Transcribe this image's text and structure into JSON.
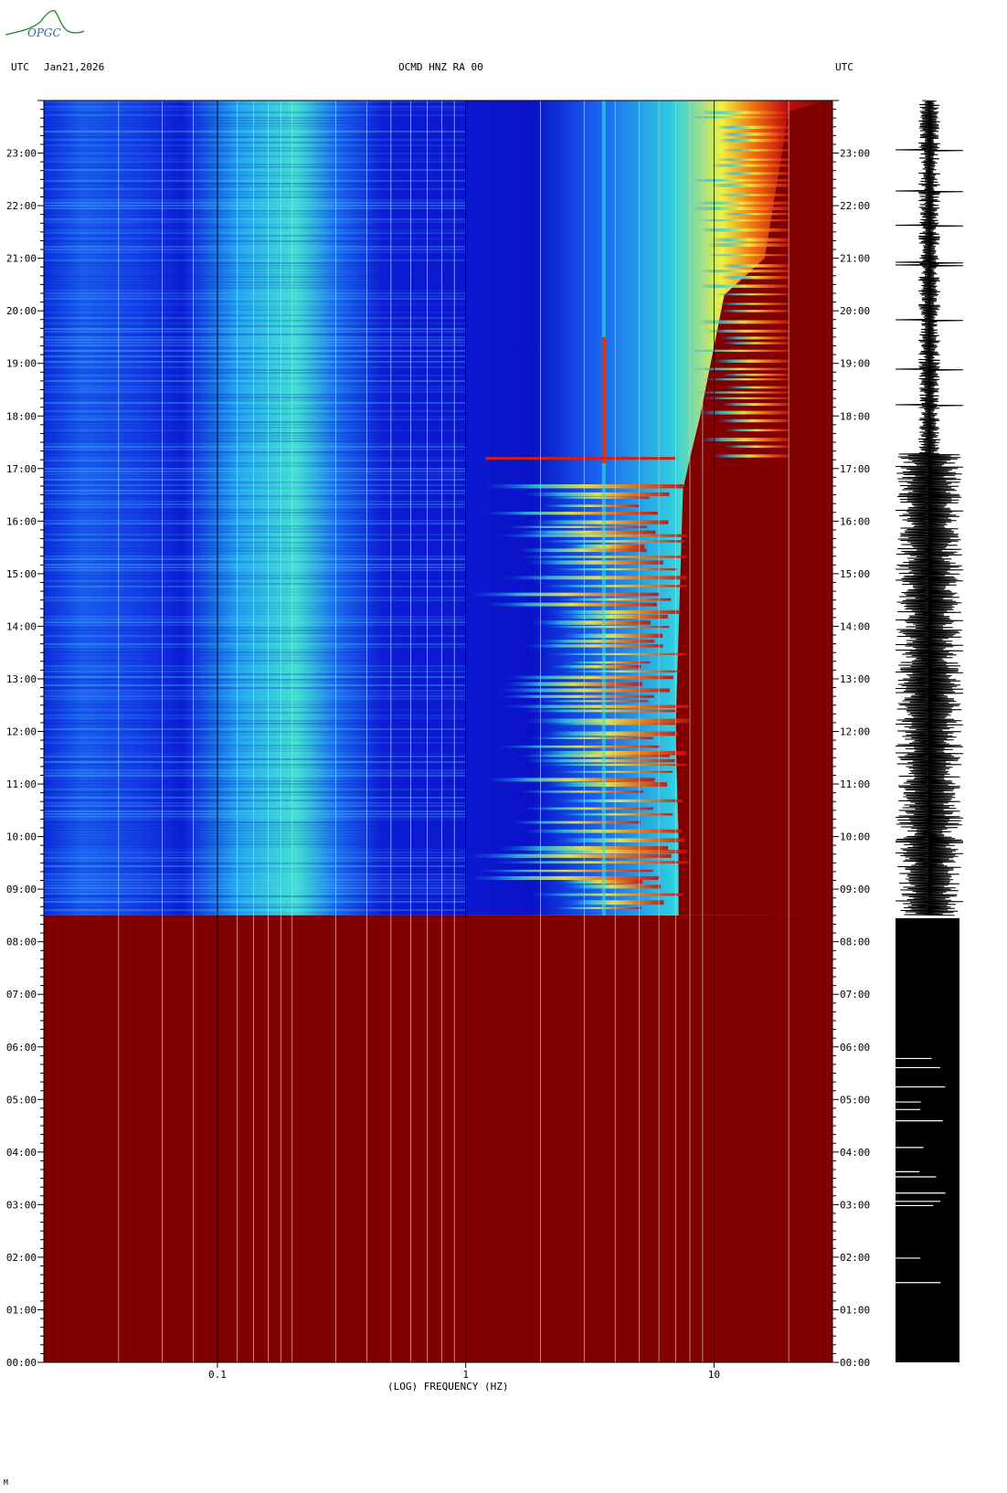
{
  "logo": {
    "text": "OPGC",
    "color": "#1a8a2a"
  },
  "header": {
    "left_label": "UTC",
    "date": "Jan21,2026",
    "title": "OCMD HNZ RA 00",
    "right_label": "UTC"
  },
  "chart_data": {
    "type": "heatmap",
    "title": "OCMD HNZ RA 00",
    "xlabel": "(LOG) FREQUENCY (HZ)",
    "xscale": "log",
    "xlim": [
      0.02,
      30
    ],
    "x_ticks": [
      {
        "value": 0.1,
        "label": "0.1"
      },
      {
        "value": 1,
        "label": "1"
      },
      {
        "value": 10,
        "label": "10"
      }
    ],
    "ylabel": "UTC",
    "ylim_hours": [
      0,
      24
    ],
    "y_ticks": [
      "00:00",
      "01:00",
      "02:00",
      "03:00",
      "04:00",
      "05:00",
      "06:00",
      "07:00",
      "08:00",
      "09:00",
      "10:00",
      "11:00",
      "12:00",
      "13:00",
      "14:00",
      "15:00",
      "16:00",
      "17:00",
      "18:00",
      "19:00",
      "20:00",
      "21:00",
      "22:00",
      "23:00"
    ],
    "no_data_before_hour": 8.5,
    "no_data_color": "#800000",
    "persistent_line_hz": 3.6,
    "colormap": [
      "#0a10d8",
      "#1a5cf0",
      "#20b0f0",
      "#40f0d0",
      "#f0f040",
      "#f07010",
      "#d01010",
      "#800000"
    ],
    "grid": true
  },
  "seismogram": {
    "label": "trace",
    "color": "#000000"
  },
  "footer_mark": "M"
}
